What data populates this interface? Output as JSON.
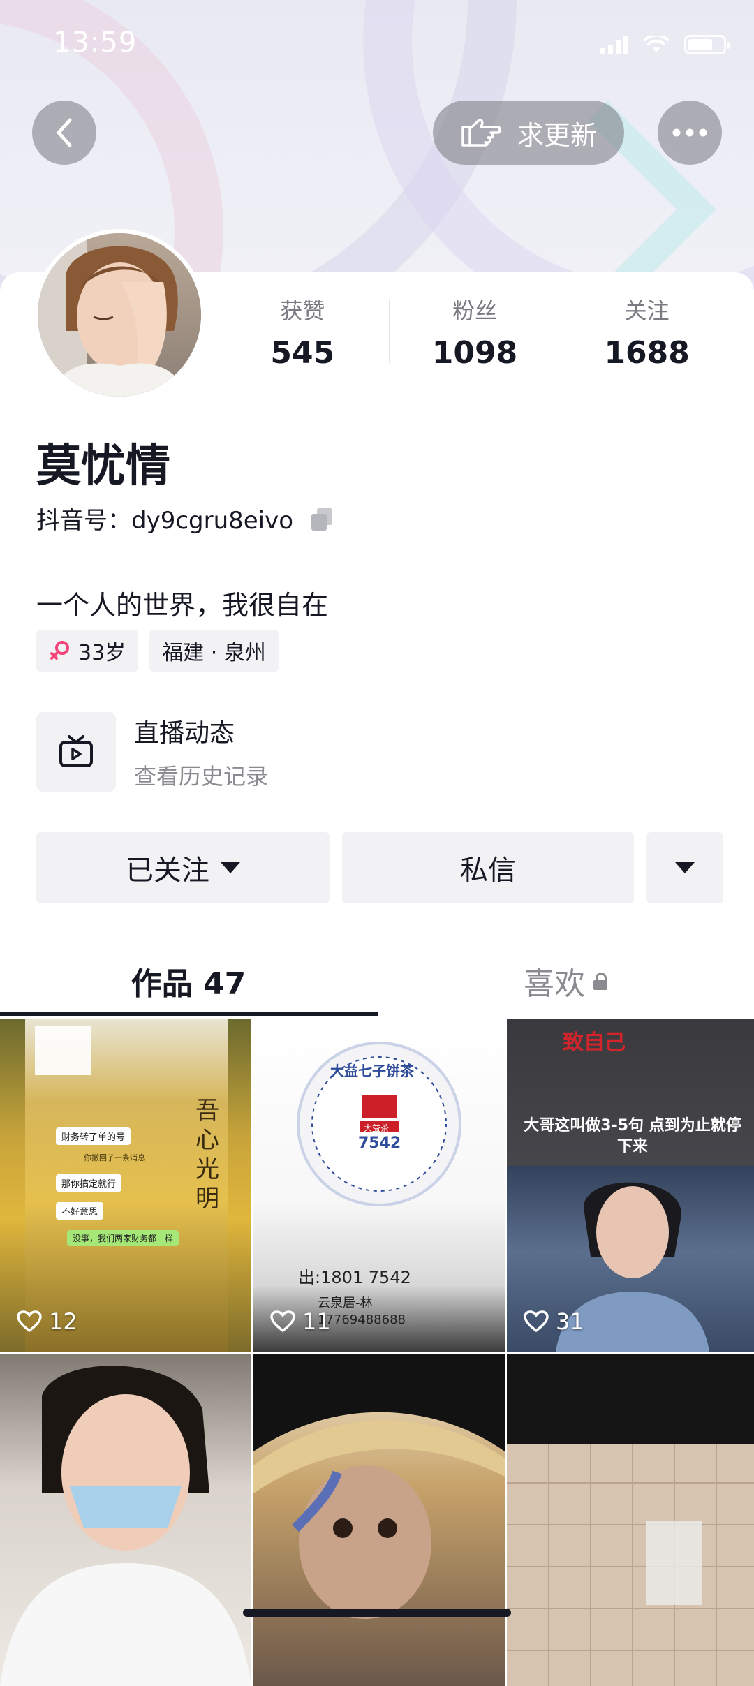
{
  "status_bar": {
    "time": "13:59"
  },
  "header": {
    "update_label": "求更新"
  },
  "profile": {
    "stats": [
      {
        "label": "获赞",
        "value": "545"
      },
      {
        "label": "粉丝",
        "value": "1098"
      },
      {
        "label": "关注",
        "value": "1688"
      }
    ],
    "nickname": "莫忧情",
    "douyin_id": "抖音号：dy9cgru8eivo",
    "bio": "一个人的世界，我很自在",
    "tags": {
      "age": "33岁",
      "location": "福建 · 泉州"
    },
    "live": {
      "title": "直播动态",
      "subtitle": "查看历史记录"
    }
  },
  "actions": {
    "follow_label": "已关注",
    "message_label": "私信"
  },
  "tabs": [
    {
      "label": "作品 47",
      "active": true
    },
    {
      "label": "喜欢",
      "active": false,
      "locked": true
    }
  ],
  "videos": [
    {
      "likes": "12"
    },
    {
      "likes": "11"
    },
    {
      "likes": "31"
    },
    {
      "likes": ""
    },
    {
      "likes": ""
    },
    {
      "likes": ""
    }
  ],
  "video_texts": {
    "v1_chat": [
      "财务转了单的号",
      "你撤回了一条消息",
      "那你搞定就行",
      "不好意思",
      "没事，我们两家财务都一样"
    ],
    "v1_calligraphy": "吾心光明",
    "v2_brand": "大益七子饼茶",
    "v2_sub": "大益茶",
    "v2_num": "7542",
    "v2_caption": "出:1801 7542",
    "v2_seller": "云泉居-林",
    "v2_phone": "17769488688",
    "v3_title": "致自己",
    "v3_caption": "大哥这叫做3-5句 点到为止就停下来"
  },
  "colors": {
    "accent_pink": "#f2467a",
    "text_primary": "#161823",
    "text_secondary": "#8a8b91"
  }
}
